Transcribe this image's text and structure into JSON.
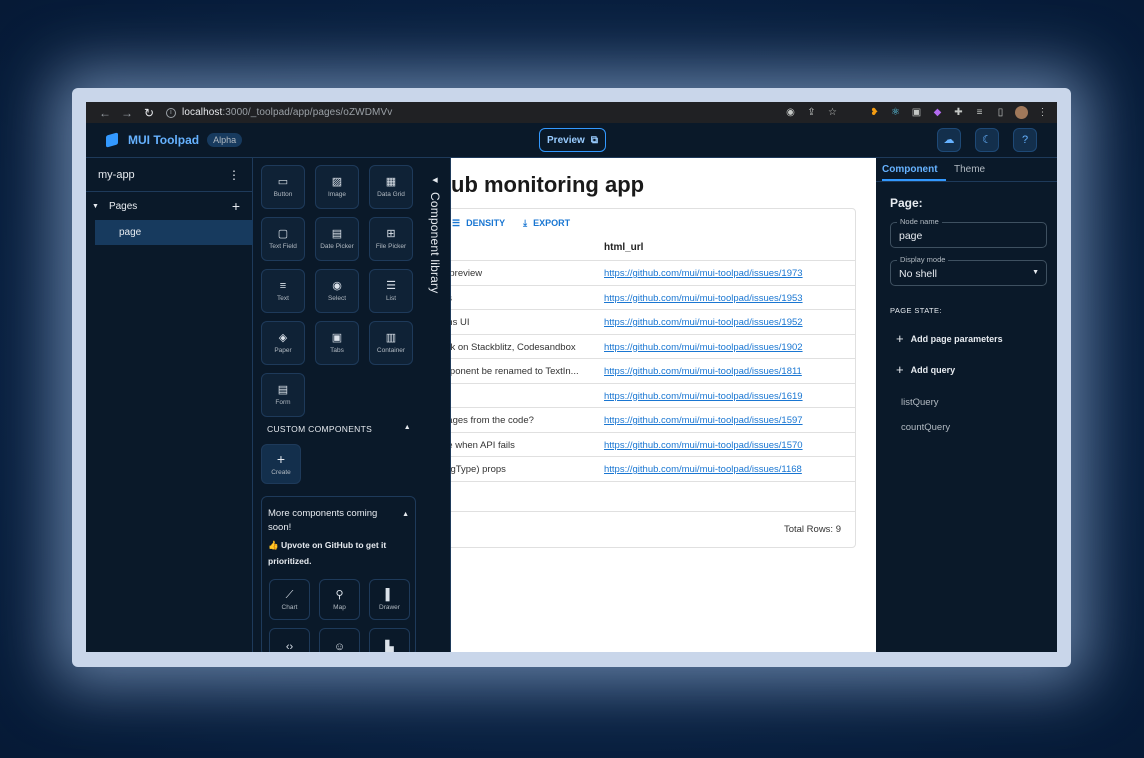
{
  "browser": {
    "url_host": "localhost",
    "url_path": ":3000/_toolpad/app/pages/oZWDMVv"
  },
  "header": {
    "brand": "MUI Toolpad",
    "badge": "Alpha",
    "preview_label": "Preview"
  },
  "sidebar": {
    "app_name": "my-app",
    "pages_label": "Pages",
    "page_item": "page"
  },
  "library": {
    "title": "Component library",
    "components": [
      {
        "label": "Button",
        "icon": "button-icon"
      },
      {
        "label": "Image",
        "icon": "image-icon"
      },
      {
        "label": "Data Grid",
        "icon": "data-grid-icon"
      },
      {
        "label": "Text Field",
        "icon": "text-field-icon"
      },
      {
        "label": "Date Picker",
        "icon": "date-picker-icon"
      },
      {
        "label": "File Picker",
        "icon": "file-picker-icon"
      },
      {
        "label": "Text",
        "icon": "text-icon"
      },
      {
        "label": "Select",
        "icon": "select-icon"
      },
      {
        "label": "List",
        "icon": "list-icon"
      },
      {
        "label": "Paper",
        "icon": "paper-icon"
      },
      {
        "label": "Tabs",
        "icon": "tabs-icon"
      },
      {
        "label": "Container",
        "icon": "container-icon"
      },
      {
        "label": "Form",
        "icon": "form-icon"
      }
    ],
    "custom_header": "CUSTOM COMPONENTS",
    "create_label": "Create",
    "more_text": "More components coming soon!",
    "upvote_text": "👍 Upvote on GitHub to get it prioritized.",
    "coming": [
      {
        "label": "Chart",
        "icon": "chart-icon"
      },
      {
        "label": "Map",
        "icon": "map-icon"
      },
      {
        "label": "Drawer",
        "icon": "drawer-icon"
      },
      {
        "label": "",
        "icon": "html-icon"
      },
      {
        "label": "",
        "icon": "emoji-icon"
      },
      {
        "label": "",
        "icon": "file-icon"
      }
    ]
  },
  "canvas": {
    "title": "ub monitoring app",
    "toolbar": {
      "density": "DENSITY",
      "export": "EXPORT"
    },
    "column_html_url": "html_url",
    "rows": [
      {
        "title": "y preview",
        "url": "https://github.com/mui/mui-toolpad/issues/1973"
      },
      {
        "title": "ns",
        "url": "https://github.com/mui/mui-toolpad/issues/1953"
      },
      {
        "title": "ons UI",
        "url": "https://github.com/mui/mui-toolpad/issues/1952"
      },
      {
        "title": "ork on Stackblitz, Codesandbox",
        "url": "https://github.com/mui/mui-toolpad/issues/1902"
      },
      {
        "title": "mponent be renamed to TextIn...",
        "url": "https://github.com/mui/mui-toolpad/issues/1811"
      },
      {
        "title": "g",
        "url": "https://github.com/mui/mui-toolpad/issues/1619"
      },
      {
        "title": "pages from the code?",
        "url": "https://github.com/mui/mui-toolpad/issues/1597"
      },
      {
        "title": "ge when API fails",
        "url": "https://github.com/mui/mui-toolpad/issues/1570"
      },
      {
        "title": "argType) props",
        "url": "https://github.com/mui/mui-toolpad/issues/1168"
      }
    ],
    "total_rows": "Total Rows: 9"
  },
  "panel": {
    "tab_component": "Component",
    "tab_theme": "Theme",
    "title": "Page:",
    "node_name_label": "Node name",
    "node_name_value": "page",
    "display_mode_label": "Display mode",
    "display_mode_value": "No shell",
    "page_state": "PAGE STATE:",
    "add_params": "Add page parameters",
    "add_query": "Add query",
    "queries": [
      "listQuery",
      "countQuery"
    ]
  },
  "colors": {
    "accent": "#3399ff",
    "bg": "#0a1929",
    "link": "#1976d2"
  }
}
